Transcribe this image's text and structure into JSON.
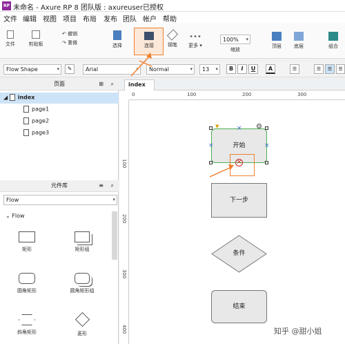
{
  "titlebar": {
    "logo": "RP",
    "title": "未命名 - Axure RP 8 团队版 : axureuser已授权"
  },
  "menu": [
    "文件",
    "编辑",
    "视图",
    "项目",
    "布局",
    "发布",
    "团队",
    "帐户",
    "帮助"
  ],
  "toolbar": {
    "file": "文件",
    "clipboard": "剪贴板",
    "undo": "撤销",
    "redo": "重做",
    "select": "选择",
    "connect": "连接",
    "pen": "钢笔",
    "more": "更多 ▾",
    "zoom_value": "100%",
    "zoom": "缩放",
    "top": "顶层",
    "bottom": "底层",
    "group": "组合"
  },
  "format": {
    "shape_select": "Flow Shape",
    "font": "Arial",
    "weight": "Normal",
    "size": "13",
    "bold": "B",
    "italic": "I",
    "underline": "U",
    "font_color": "A"
  },
  "pages": {
    "header": "页面",
    "root": "index",
    "items": [
      "page1",
      "page2",
      "page3"
    ]
  },
  "library": {
    "header": "元件库",
    "dropdown": "Flow",
    "section": "Flow",
    "widgets": [
      "矩形",
      "矩形组",
      "圆角矩形",
      "圆角矩形组",
      "斜角矩形",
      "菱形"
    ]
  },
  "canvas": {
    "tab": "index",
    "ruler_h": [
      "0",
      "100",
      "200",
      "300"
    ],
    "ruler_v": [
      "100",
      "200",
      "300",
      "400"
    ],
    "shapes": {
      "start": "开始",
      "next": "下一步",
      "condition": "条件",
      "end": "结束"
    }
  },
  "colors": {
    "highlight": "#f08030",
    "selection": "#4caf50",
    "accent": "#3368c8"
  },
  "watermark": "知乎 @甜小姐"
}
